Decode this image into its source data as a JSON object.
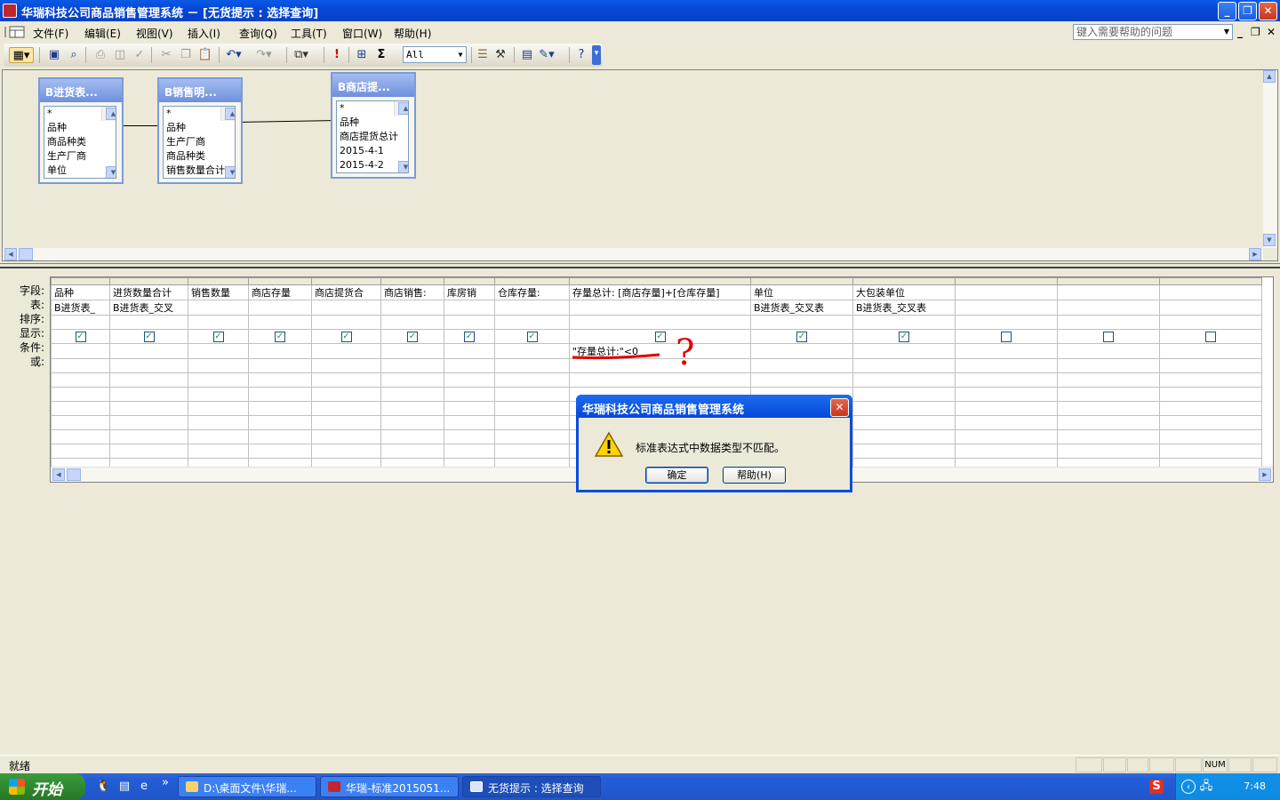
{
  "window": {
    "title": "华瑞科技公司商品销售管理系统 － [无货提示 : 选择查询]",
    "minimize": "_",
    "restore": "❐",
    "close": "✕"
  },
  "menu": {
    "items": [
      "文件(F)",
      "编辑(E)",
      "视图(V)",
      "插入(I)",
      "查询(Q)",
      "工具(T)",
      "窗口(W)",
      "帮助(H)"
    ],
    "help_placeholder": "键入需要帮助的问题",
    "mdi_min": "_",
    "mdi_restore": "❐",
    "mdi_close": "✕"
  },
  "toolbar": {
    "top_value": "All"
  },
  "design": {
    "tables": [
      {
        "title": "B进货表...",
        "fields": [
          "*",
          "品种",
          "商品种类",
          "生产厂商",
          "单位"
        ]
      },
      {
        "title": "B销售明...",
        "fields": [
          "*",
          "品种",
          "生产厂商",
          "商品种类",
          "销售数量合计"
        ]
      },
      {
        "title": "B商店提...",
        "fields": [
          "*",
          "品种",
          "商店提货总计",
          "2015-4-1",
          "2015-4-2"
        ]
      }
    ]
  },
  "grid": {
    "row_labels": [
      "字段:",
      "表:",
      "排序:",
      "显示:",
      "条件:",
      "或:"
    ],
    "columns": [
      {
        "field": "品种",
        "table": "B进货表_",
        "show": true,
        "criteria": ""
      },
      {
        "field": "进货数量合计",
        "table": "B进货表_交叉",
        "show": true,
        "criteria": ""
      },
      {
        "field": "销售数量",
        "table": "",
        "show": true,
        "criteria": ""
      },
      {
        "field": "商店存量",
        "table": "",
        "show": true,
        "criteria": ""
      },
      {
        "field": "商店提货合",
        "table": "",
        "show": true,
        "criteria": ""
      },
      {
        "field": "商店销售:",
        "table": "",
        "show": true,
        "criteria": ""
      },
      {
        "field": "库房销",
        "table": "",
        "show": true,
        "criteria": ""
      },
      {
        "field": "仓库存量:",
        "table": "",
        "show": true,
        "criteria": ""
      },
      {
        "field": "存量总计: [商店存量]+[仓库存量]",
        "table": "",
        "show": true,
        "criteria": "\"存量总计:\"<0"
      },
      {
        "field": "单位",
        "table": "B进货表_交叉表",
        "show": true,
        "criteria": ""
      },
      {
        "field": "大包装单位",
        "table": "B进货表_交叉表",
        "show": true,
        "criteria": ""
      },
      {
        "field": "",
        "table": "",
        "show": false,
        "criteria": ""
      },
      {
        "field": "",
        "table": "",
        "show": false,
        "criteria": ""
      },
      {
        "field": "",
        "table": "",
        "show": false,
        "criteria": ""
      }
    ]
  },
  "annotation": {
    "mark": "?"
  },
  "dialog": {
    "title": "华瑞科技公司商品销售管理系统",
    "message": "标准表达式中数据类型不匹配。",
    "ok_label": "确定",
    "help_label": "帮助(H)",
    "close": "✕"
  },
  "status": {
    "text": "就绪",
    "num": "NUM"
  },
  "taskbar": {
    "start_label": "开始",
    "quicklaunch_more": "»",
    "buttons": [
      {
        "label": "D:\\桌面文件\\华瑞..."
      },
      {
        "label": "华瑞-标准2015051..."
      },
      {
        "label": "无货提示 : 选择查询"
      }
    ],
    "clock": "7:48"
  },
  "colors": {
    "titlebar": "#0548d8",
    "annotation_red": "#e00000",
    "checkmark": "#21a121"
  }
}
